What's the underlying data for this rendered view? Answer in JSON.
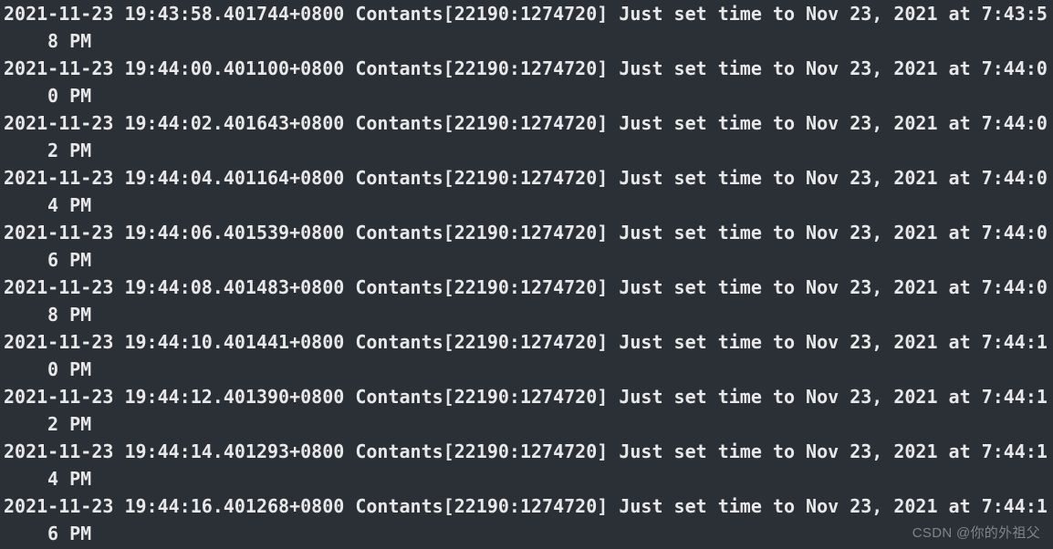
{
  "log": {
    "lines": [
      {
        "ts": "2021-11-23 19:43:58.401744+0800",
        "proc": "Contants[22190:1274720]",
        "msg": "Just set time to Nov 23, 2021 at 7:43:58 PM"
      },
      {
        "ts": "2021-11-23 19:44:00.401100+0800",
        "proc": "Contants[22190:1274720]",
        "msg": "Just set time to Nov 23, 2021 at 7:44:00 PM"
      },
      {
        "ts": "2021-11-23 19:44:02.401643+0800",
        "proc": "Contants[22190:1274720]",
        "msg": "Just set time to Nov 23, 2021 at 7:44:02 PM"
      },
      {
        "ts": "2021-11-23 19:44:04.401164+0800",
        "proc": "Contants[22190:1274720]",
        "msg": "Just set time to Nov 23, 2021 at 7:44:04 PM"
      },
      {
        "ts": "2021-11-23 19:44:06.401539+0800",
        "proc": "Contants[22190:1274720]",
        "msg": "Just set time to Nov 23, 2021 at 7:44:06 PM"
      },
      {
        "ts": "2021-11-23 19:44:08.401483+0800",
        "proc": "Contants[22190:1274720]",
        "msg": "Just set time to Nov 23, 2021 at 7:44:08 PM"
      },
      {
        "ts": "2021-11-23 19:44:10.401441+0800",
        "proc": "Contants[22190:1274720]",
        "msg": "Just set time to Nov 23, 2021 at 7:44:10 PM"
      },
      {
        "ts": "2021-11-23 19:44:12.401390+0800",
        "proc": "Contants[22190:1274720]",
        "msg": "Just set time to Nov 23, 2021 at 7:44:12 PM"
      },
      {
        "ts": "2021-11-23 19:44:14.401293+0800",
        "proc": "Contants[22190:1274720]",
        "msg": "Just set time to Nov 23, 2021 at 7:44:14 PM"
      },
      {
        "ts": "2021-11-23 19:44:16.401268+0800",
        "proc": "Contants[22190:1274720]",
        "msg": "Just set time to Nov 23, 2021 at 7:44:16 PM"
      }
    ]
  },
  "watermark": "CSDN @你的外祖父"
}
